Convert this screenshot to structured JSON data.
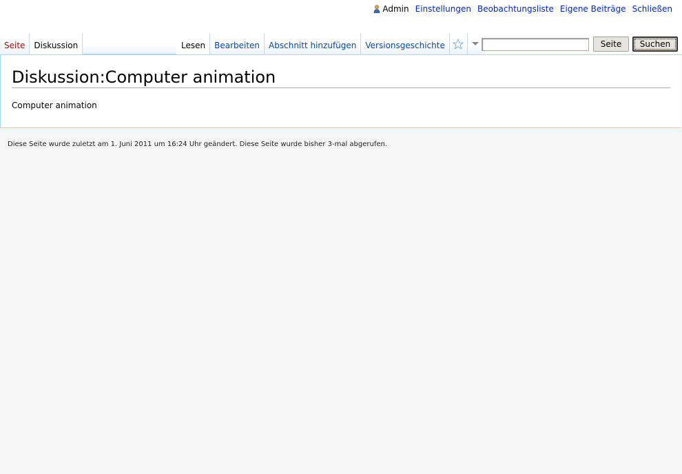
{
  "personal": {
    "username": "Admin",
    "links": [
      "Einstellungen",
      "Beobachtungsliste",
      "Eigene Beiträge",
      "Schließen"
    ]
  },
  "namespaces": {
    "page": "Seite",
    "talk": "Diskussion"
  },
  "views": {
    "read": "Lesen",
    "edit": "Bearbeiten",
    "add_section": "Abschnitt hinzufügen",
    "history": "Versionsgeschichte"
  },
  "search": {
    "value": "",
    "go_label": "Seite",
    "search_label": "Suchen"
  },
  "page": {
    "title": "Diskussion:Computer animation",
    "body": "Computer animation"
  },
  "footer": {
    "text": "Diese Seite wurde zuletzt am 1. Juni 2011 um 16:24 Uhr geändert. Diese Seite wurde bisher 3-mal abgerufen."
  },
  "colors": {
    "link": "#0645ad",
    "new_link": "#ba0000",
    "border": "#a7d7f9",
    "background": "#f6f6f6"
  }
}
